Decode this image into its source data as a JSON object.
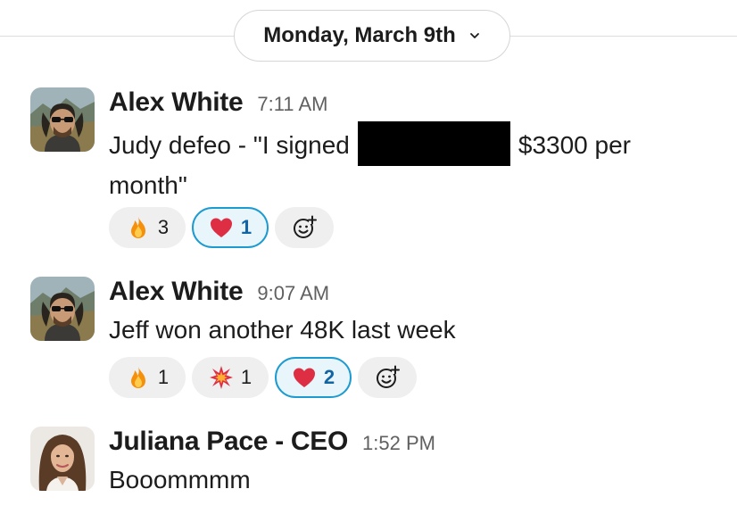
{
  "date_divider": {
    "label": "Monday, March 9th"
  },
  "messages": [
    {
      "author": "Alex White",
      "time": "7:11 AM",
      "text_before": "Judy defeo - \"I signed",
      "text_after": "$3300 per",
      "text_line2": "month\"",
      "reactions": [
        {
          "emoji": "fire-emoji",
          "count": "3",
          "active": false
        },
        {
          "emoji": "heart-emoji",
          "count": "1",
          "active": true
        }
      ]
    },
    {
      "author": "Alex White",
      "time": "9:07 AM",
      "text": "Jeff won another 48K last week",
      "reactions": [
        {
          "emoji": "fire-emoji",
          "count": "1",
          "active": false
        },
        {
          "emoji": "collision-emoji",
          "count": "1",
          "active": false
        },
        {
          "emoji": "heart-emoji",
          "count": "2",
          "active": true
        }
      ]
    },
    {
      "author": "Juliana Pace - CEO",
      "time": "1:52 PM",
      "text": "Booommmm"
    }
  ],
  "colors": {
    "active_reaction_border": "#1d9bd1",
    "active_reaction_text": "#1264a3"
  }
}
